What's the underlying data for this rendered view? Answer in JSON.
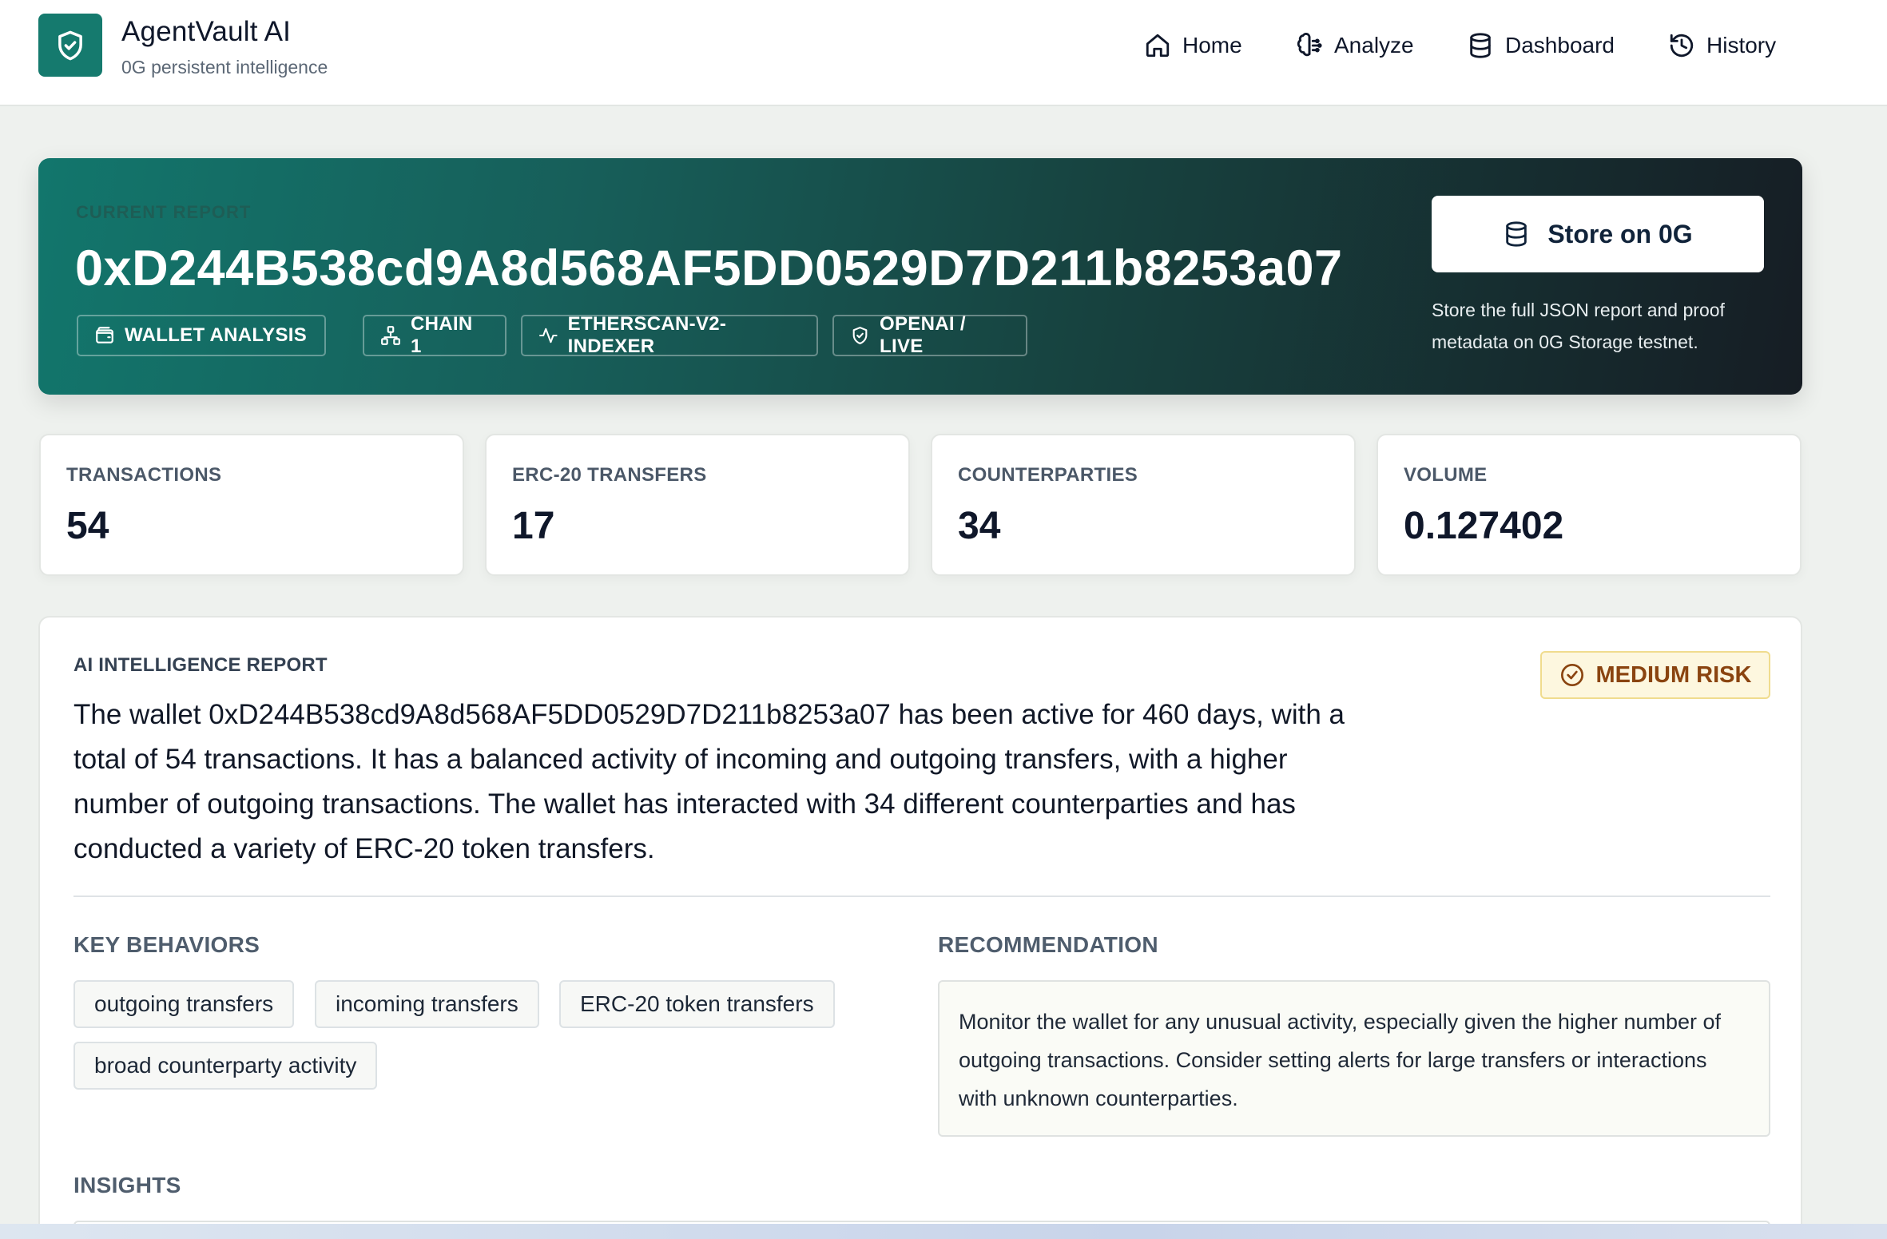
{
  "header": {
    "app_name": "AgentVault AI",
    "tagline": "0G persistent intelligence",
    "nav": [
      {
        "label": "Home",
        "icon": "home-icon"
      },
      {
        "label": "Analyze",
        "icon": "brain-icon"
      },
      {
        "label": "Dashboard",
        "icon": "database-icon"
      },
      {
        "label": "History",
        "icon": "history-icon"
      }
    ]
  },
  "hero": {
    "eyebrow": "CURRENT REPORT",
    "address": "0xD244B538cd9A8d568AF5DD0529D7D211b8253a07",
    "tags": [
      {
        "label": "WALLET ANALYSIS",
        "icon": "wallet-icon"
      },
      {
        "label": "CHAIN 1",
        "icon": "network-icon"
      },
      {
        "label": "ETHERSCAN-V2-INDEXER",
        "icon": "activity-icon"
      },
      {
        "label": "OPENAI / LIVE",
        "icon": "shield-check-icon"
      }
    ],
    "store_button": "Store on 0G",
    "store_note": "Store the full JSON report and proof metadata on 0G Storage testnet."
  },
  "stats": [
    {
      "label": "TRANSACTIONS",
      "value": "54"
    },
    {
      "label": "ERC-20 TRANSFERS",
      "value": "17"
    },
    {
      "label": "COUNTERPARTIES",
      "value": "34"
    },
    {
      "label": "VOLUME",
      "value": "0.127402"
    }
  ],
  "report": {
    "eyebrow": "AI INTELLIGENCE REPORT",
    "risk": "MEDIUM RISK",
    "summary": "The wallet 0xD244B538cd9A8d568AF5DD0529D7D211b8253a07 has been active for 460 days, with a total of 54 transactions. It has a balanced activity of incoming and outgoing transfers, with a higher number of outgoing transactions. The wallet has interacted with 34 different counterparties and has conducted a variety of ERC-20 token transfers.",
    "key_behaviors_title": "KEY BEHAVIORS",
    "key_behaviors": [
      "outgoing transfers",
      "incoming transfers",
      "ERC-20 token transfers",
      "broad counterparty activity"
    ],
    "recommendation_title": "RECOMMENDATION",
    "recommendation": "Monitor the wallet for any unusual activity, especially given the higher number of outgoing transactions. Consider setting alerts for large transfers or interactions with unknown counterparties.",
    "insights_title": "INSIGHTS"
  },
  "colors": {
    "brand": "#157a6e",
    "risk_bg": "#fdf7df",
    "risk_text": "#8a4410"
  }
}
